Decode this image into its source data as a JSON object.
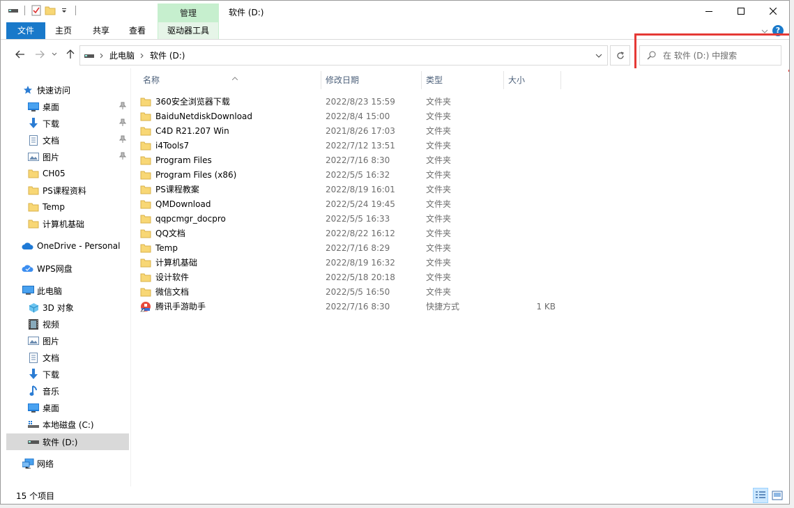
{
  "window": {
    "title": "软件 (D:)"
  },
  "ribbon": {
    "context_header": "管理",
    "tabs": [
      {
        "label": "文件"
      },
      {
        "label": "主页"
      },
      {
        "label": "共享"
      },
      {
        "label": "查看"
      },
      {
        "label": "驱动器工具"
      }
    ]
  },
  "address": {
    "crumbs": [
      "此电脑",
      "软件 (D:)"
    ]
  },
  "search": {
    "placeholder": "在 软件 (D:) 中搜索"
  },
  "nav": {
    "items": [
      {
        "label": "快速访问",
        "icon": "star-icon"
      },
      {
        "label": "桌面",
        "icon": "desktop-icon",
        "pinned": true
      },
      {
        "label": "下载",
        "icon": "download-icon",
        "pinned": true
      },
      {
        "label": "文档",
        "icon": "document-icon",
        "pinned": true
      },
      {
        "label": "图片",
        "icon": "picture-icon",
        "pinned": true
      },
      {
        "label": "CH05",
        "icon": "folder-icon"
      },
      {
        "label": "PS课程资料",
        "icon": "folder-icon"
      },
      {
        "label": "Temp",
        "icon": "folder-icon"
      },
      {
        "label": "计算机基础",
        "icon": "folder-icon"
      },
      {
        "label": "OneDrive - Personal",
        "icon": "cloud-icon"
      },
      {
        "label": "WPS网盘",
        "icon": "wps-cloud-icon"
      },
      {
        "label": "此电脑",
        "icon": "computer-icon"
      },
      {
        "label": "3D 对象",
        "icon": "cube-icon"
      },
      {
        "label": "视频",
        "icon": "video-icon"
      },
      {
        "label": "图片",
        "icon": "picture-icon"
      },
      {
        "label": "文档",
        "icon": "document-icon"
      },
      {
        "label": "下载",
        "icon": "download-icon"
      },
      {
        "label": "音乐",
        "icon": "music-icon"
      },
      {
        "label": "桌面",
        "icon": "desktop-icon"
      },
      {
        "label": "本地磁盘 (C:)",
        "icon": "os-drive-icon"
      },
      {
        "label": "软件 (D:)",
        "icon": "drive-icon",
        "selected": true
      },
      {
        "label": "网络",
        "icon": "network-icon"
      }
    ]
  },
  "columns": {
    "name": "名称",
    "date": "修改日期",
    "type": "类型",
    "size": "大小"
  },
  "files": [
    {
      "name": "360安全浏览器下载",
      "date": "2022/8/23 15:59",
      "type": "文件夹",
      "size": ""
    },
    {
      "name": "BaiduNetdiskDownload",
      "date": "2022/8/4 15:00",
      "type": "文件夹",
      "size": ""
    },
    {
      "name": "C4D R21.207 Win",
      "date": "2021/8/26 17:03",
      "type": "文件夹",
      "size": ""
    },
    {
      "name": "i4Tools7",
      "date": "2022/7/12 13:51",
      "type": "文件夹",
      "size": ""
    },
    {
      "name": "Program Files",
      "date": "2022/7/16 8:30",
      "type": "文件夹",
      "size": ""
    },
    {
      "name": "Program Files (x86)",
      "date": "2022/5/5 16:32",
      "type": "文件夹",
      "size": ""
    },
    {
      "name": "PS课程教案",
      "date": "2022/8/19 16:01",
      "type": "文件夹",
      "size": ""
    },
    {
      "name": "QMDownload",
      "date": "2022/5/24 19:45",
      "type": "文件夹",
      "size": ""
    },
    {
      "name": "qqpcmgr_docpro",
      "date": "2022/5/5 16:33",
      "type": "文件夹",
      "size": ""
    },
    {
      "name": "QQ文档",
      "date": "2022/8/22 16:12",
      "type": "文件夹",
      "size": ""
    },
    {
      "name": "Temp",
      "date": "2022/7/16 8:29",
      "type": "文件夹",
      "size": ""
    },
    {
      "name": "计算机基础",
      "date": "2022/8/19 16:32",
      "type": "文件夹",
      "size": ""
    },
    {
      "name": "设计软件",
      "date": "2022/5/18 20:18",
      "type": "文件夹",
      "size": ""
    },
    {
      "name": "微信文档",
      "date": "2022/5/5 16:50",
      "type": "文件夹",
      "size": ""
    },
    {
      "name": "腾讯手游助手",
      "date": "2022/7/16 8:30",
      "type": "快捷方式",
      "size": "1 KB"
    }
  ],
  "status": {
    "count": "15 个项目"
  },
  "colors": {
    "accent": "#1979ca",
    "context_tab": "#c6efce",
    "folder": "#f8d775",
    "highlight": "#e53935"
  }
}
